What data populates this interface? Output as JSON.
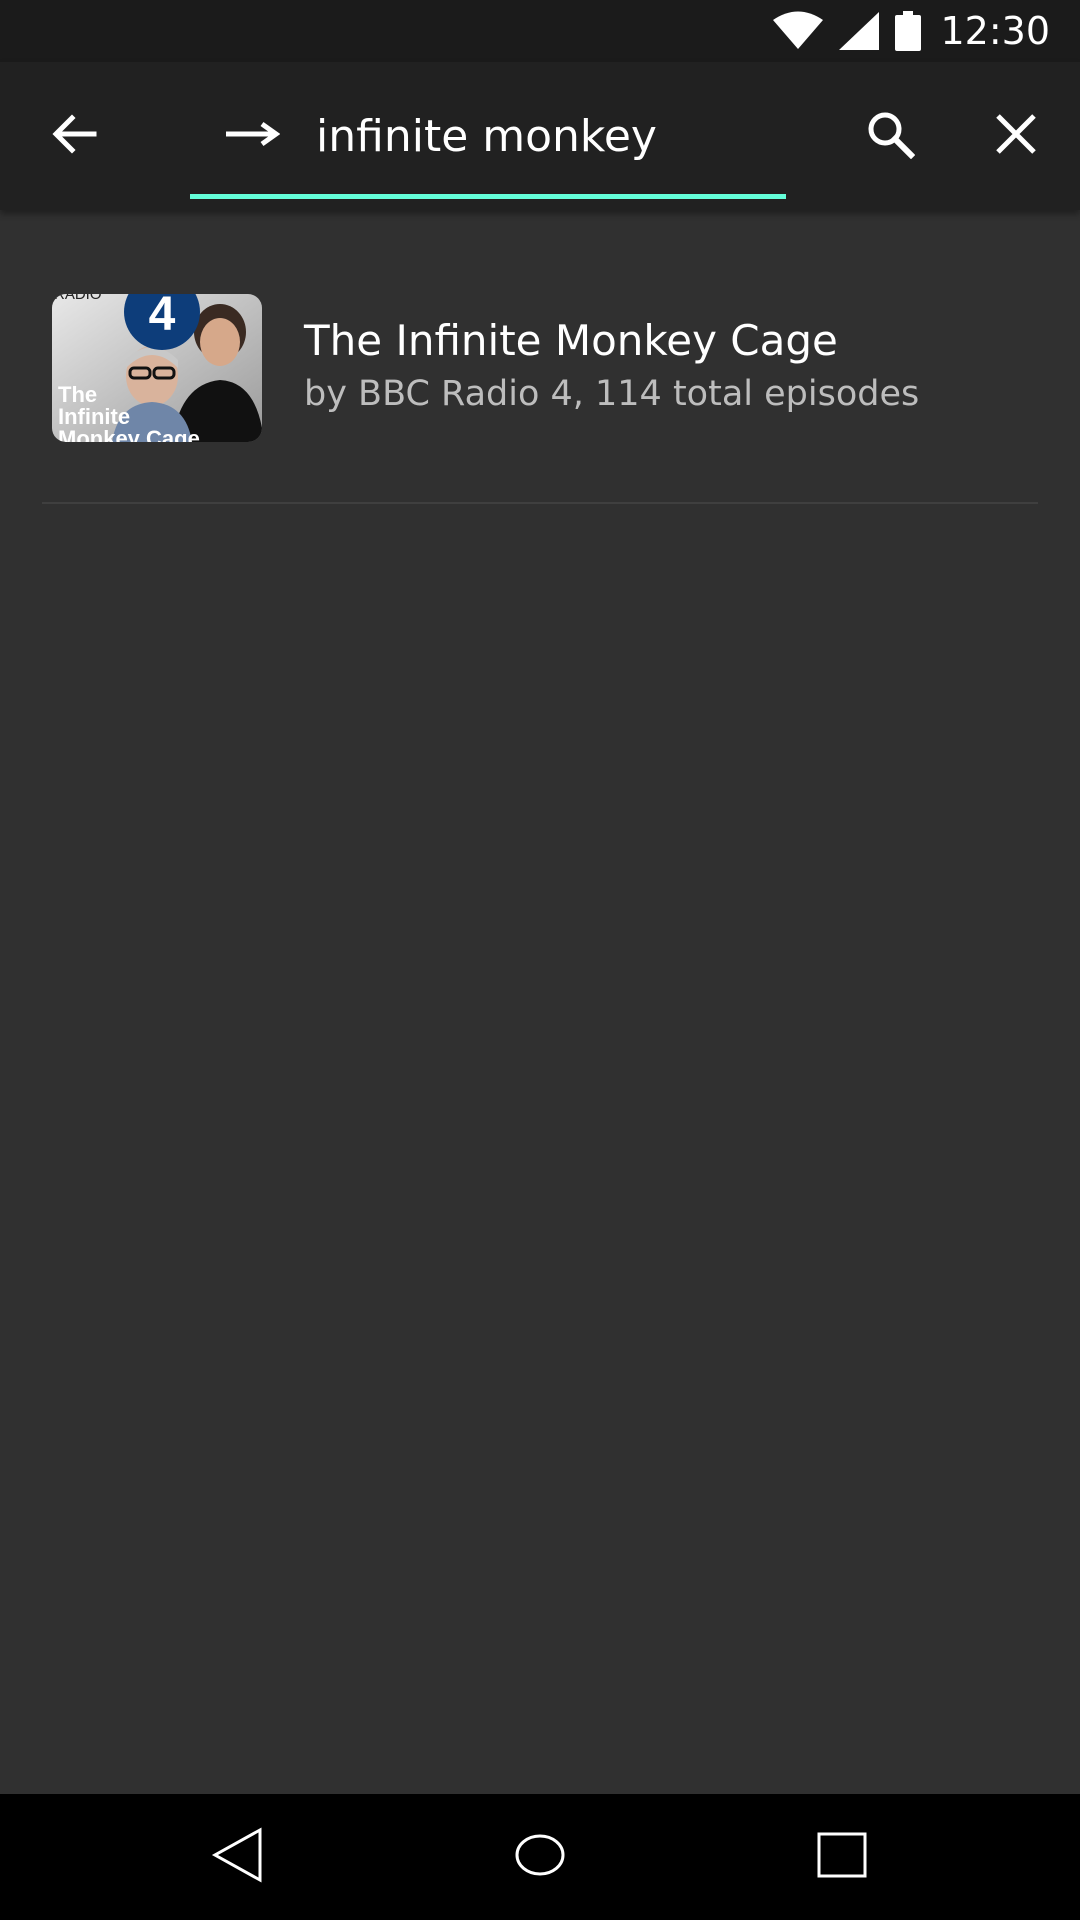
{
  "status_bar": {
    "time": "12:30",
    "icons": [
      "wifi-icon",
      "cell-signal-icon",
      "battery-icon"
    ]
  },
  "toolbar": {
    "back_icon": "arrow-back-icon",
    "search_mode_icon": "arrow-forward-icon",
    "search_value": "infinite monkey",
    "search_icon": "search-icon",
    "clear_icon": "close-icon",
    "accent_color": "#64ffda"
  },
  "results": [
    {
      "title": "The Infinite Monkey Cage",
      "subtitle": "by BBC Radio 4, 114 total episodes",
      "artwork": {
        "label_top": "RADIO",
        "badge": "4",
        "label_bottom": "The Infinite Monkey Cage"
      }
    }
  ],
  "nav_bar": {
    "icons": [
      "nav-back-icon",
      "nav-home-icon",
      "nav-recents-icon"
    ]
  },
  "colors": {
    "background": "#303030",
    "toolbar": "#212121",
    "status_bar": "#1b1b1b",
    "nav_bar": "#000000",
    "title_text": "#ffffff",
    "subtitle_text": "#bdbdbd"
  }
}
